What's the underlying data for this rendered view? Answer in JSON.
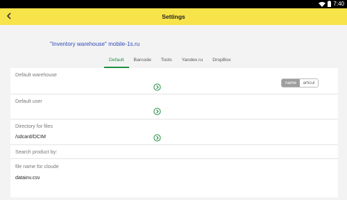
{
  "status_bar": {
    "time": "7:40",
    "icons": [
      "wifi-icon",
      "battery-icon"
    ]
  },
  "app_bar": {
    "title": "Settings",
    "back_icon": "chevron-left-icon",
    "color": "#f7e34a"
  },
  "company": "\"Inventory warehouse\" mobile-1s.ru",
  "tabs": [
    {
      "label": "Default",
      "active": true
    },
    {
      "label": "Barcode",
      "active": false
    },
    {
      "label": "Tools",
      "active": false
    },
    {
      "label": "Yandex.ru",
      "active": false
    },
    {
      "label": "DropBox",
      "active": false
    }
  ],
  "settings": {
    "default_warehouse": {
      "label": "Default warehouse",
      "value": ""
    },
    "default_user": {
      "label": "Default user",
      "value": ""
    },
    "directory": {
      "label": "Directory for files",
      "value": "/sdcard/DCIM"
    },
    "search_by": {
      "label": "Search product by:",
      "options": [
        "name",
        "articul"
      ],
      "selected": "name"
    },
    "cloud_file": {
      "label": "file name for cloude",
      "value": "datainv.csv"
    }
  },
  "colors": {
    "accent": "#1e8e3e",
    "company_text": "#2e4bb8"
  }
}
